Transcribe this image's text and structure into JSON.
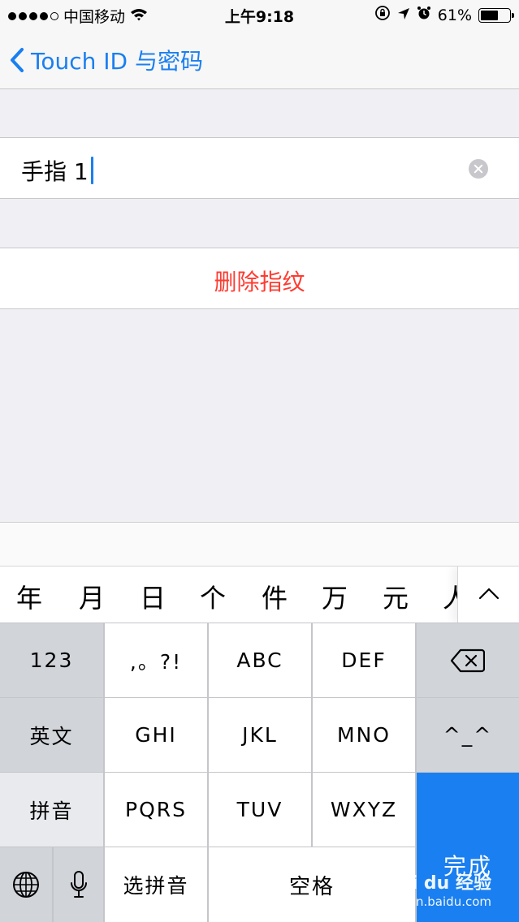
{
  "status_bar": {
    "carrier": "中国移动",
    "time": "上午9:18",
    "battery": "61%",
    "battery_level": 0.61,
    "icons": [
      "wifi-icon",
      "orientation-lock-icon",
      "location-icon",
      "alarm-icon",
      "battery-icon"
    ]
  },
  "nav": {
    "back_label": "Touch ID 与密码"
  },
  "finger": {
    "name_value": "手指 1"
  },
  "actions": {
    "delete_label": "删除指纹"
  },
  "candidates": [
    "年",
    "月",
    "日",
    "个",
    "件",
    "万",
    "元",
    "人"
  ],
  "keyboard": {
    "k123": "123",
    "punct": ",。?!",
    "abc": "ABC",
    "def": "DEF",
    "english": "英文",
    "ghi": "GHI",
    "jkl": "JKL",
    "mno": "MNO",
    "emoticon": "^_^",
    "pinyin": "拼音",
    "pqrs": "PQRS",
    "tuv": "TUV",
    "wxyz": "WXYZ",
    "select_pinyin": "选拼音",
    "space": "空格",
    "done": "完成"
  },
  "watermark": {
    "brand": "Bai du 经验",
    "url": "jingyan.baidu.com"
  },
  "colors": {
    "accent": "#1a7ff0",
    "destructive": "#ff3b30",
    "background": "#efeff4"
  }
}
